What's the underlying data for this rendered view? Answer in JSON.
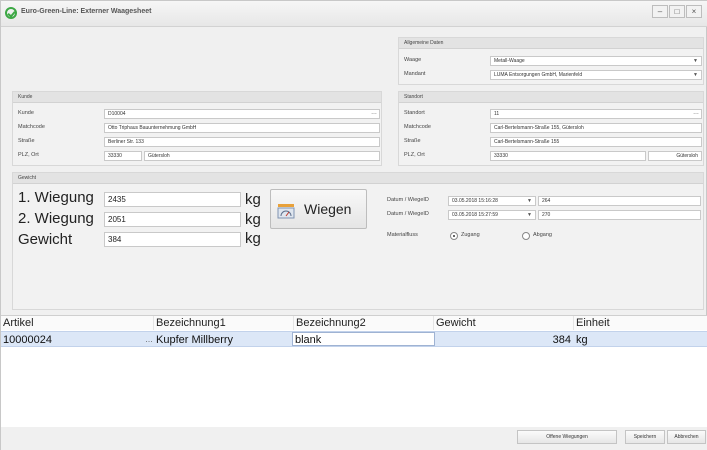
{
  "window": {
    "title": "Euro-Green-Line: Externer Waagesheet",
    "controls": [
      "–",
      "□",
      "×"
    ]
  },
  "allgemein": {
    "header": "Allgemeine Daten",
    "waage_label": "Waage",
    "waage_value": "Metall-Waage",
    "mandant_label": "Mandant",
    "mandant_value": "LUMA Entsorgungen GmbH, Marienfeld"
  },
  "kunde": {
    "header": "Kunde",
    "kunde_label": "Kunde",
    "kunde_value": "D10004",
    "matchcode_label": "Matchcode",
    "matchcode_value": "Otto Triphaus Bauunternehmung GmbH",
    "strasse_label": "Straße",
    "strasse_value": "Berliner Str. 133",
    "plz_label": "PLZ, Ort",
    "plz_value": "33330",
    "ort_value": "Gütersloh"
  },
  "standort": {
    "header": "Standort",
    "standort_label": "Standort",
    "standort_value": "11",
    "matchcode_label": "Matchcode",
    "matchcode_value": "Carl-Bertelsmann-Straße 155, Gütersloh",
    "strasse_label": "Straße",
    "strasse_value": "Carl-Bertelsmann-Straße 155",
    "plz_label": "PLZ, Ort",
    "plz_value": "33330",
    "ort_value": "Gütersloh"
  },
  "gewicht": {
    "header": "Gewicht",
    "w1_label": "1. Wiegung",
    "w1_value": "2435",
    "w2_label": "2. Wiegung",
    "w2_value": "2051",
    "total_label": "Gewicht",
    "total_value": "384",
    "unit": "kg",
    "wiegen_label": "Wiegen",
    "datum1_label": "Datum / WiegeID",
    "datum1_value": "03.05.2018 15:16:28",
    "id1_value": "264",
    "datum2_label": "Datum / WiegeID",
    "datum2_value": "03.05.2018 15:27:59",
    "id2_value": "270",
    "materialfluss_label": "Materialfluss",
    "zugang_label": "Zugang",
    "abgang_label": "Abgang",
    "materialfluss_selected": "Zugang"
  },
  "grid": {
    "columns": [
      "Artikel",
      "Bezeichnung1",
      "Bezeichnung2",
      "Gewicht",
      "Einheit"
    ],
    "rows": [
      {
        "artikel": "10000024",
        "bez1": "Kupfer Millberry",
        "bez2": "blank",
        "gewicht": "384",
        "einheit": "kg"
      }
    ]
  },
  "footer": {
    "offene_label": "Offene Wiegungen",
    "speichern_label": "Speichern",
    "abbrechen_label": "Abbrechen"
  },
  "colors": {
    "accent_green": "#3da845",
    "selection": "#dce7f7"
  }
}
